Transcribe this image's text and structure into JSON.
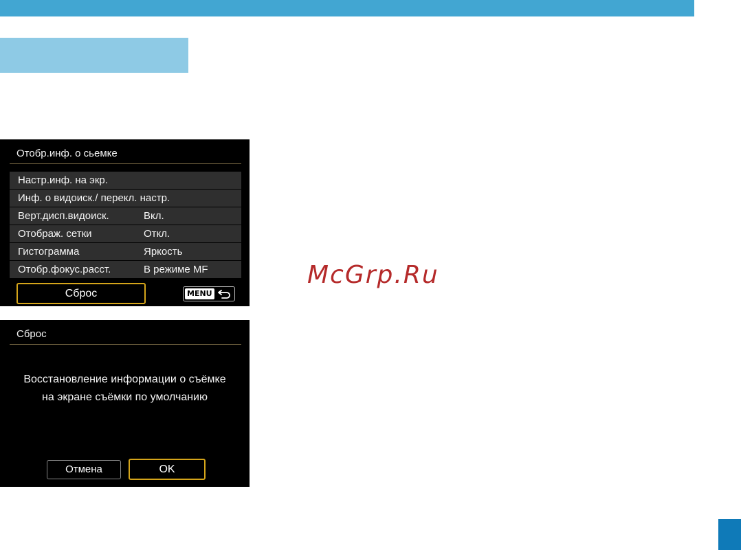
{
  "colors": {
    "top_bar": "#42a6d2",
    "section_tab": "#8ecae5",
    "page_marker": "#0f7ab8",
    "selection_border": "#d5a51a",
    "watermark": "#b52a2a"
  },
  "watermark": "McGrp.Ru",
  "screen1": {
    "title": "Отобр.инф. о сьемке",
    "items": [
      {
        "label": "Настр.инф. на экр.",
        "value": ""
      },
      {
        "label": "Инф. о видоиск./ перекл. настр.",
        "value": ""
      },
      {
        "label": "Верт.дисп.видоиск.",
        "value": "Вкл."
      },
      {
        "label": "Отображ. сетки",
        "value": "Откл."
      },
      {
        "label": "Гистограмма",
        "value": "Яркость"
      },
      {
        "label": "Отобр.фокус.расст.",
        "value": "В режиме MF"
      }
    ],
    "reset_label": "Сброс",
    "menu_label": "MENU",
    "back_icon": "return-arrow-icon"
  },
  "screen2": {
    "title": "Сброс",
    "message_line1": "Восстановление информации о съёмке",
    "message_line2": "на экране съёмки по умолчанию",
    "cancel_label": "Отмена",
    "ok_label": "OK"
  }
}
